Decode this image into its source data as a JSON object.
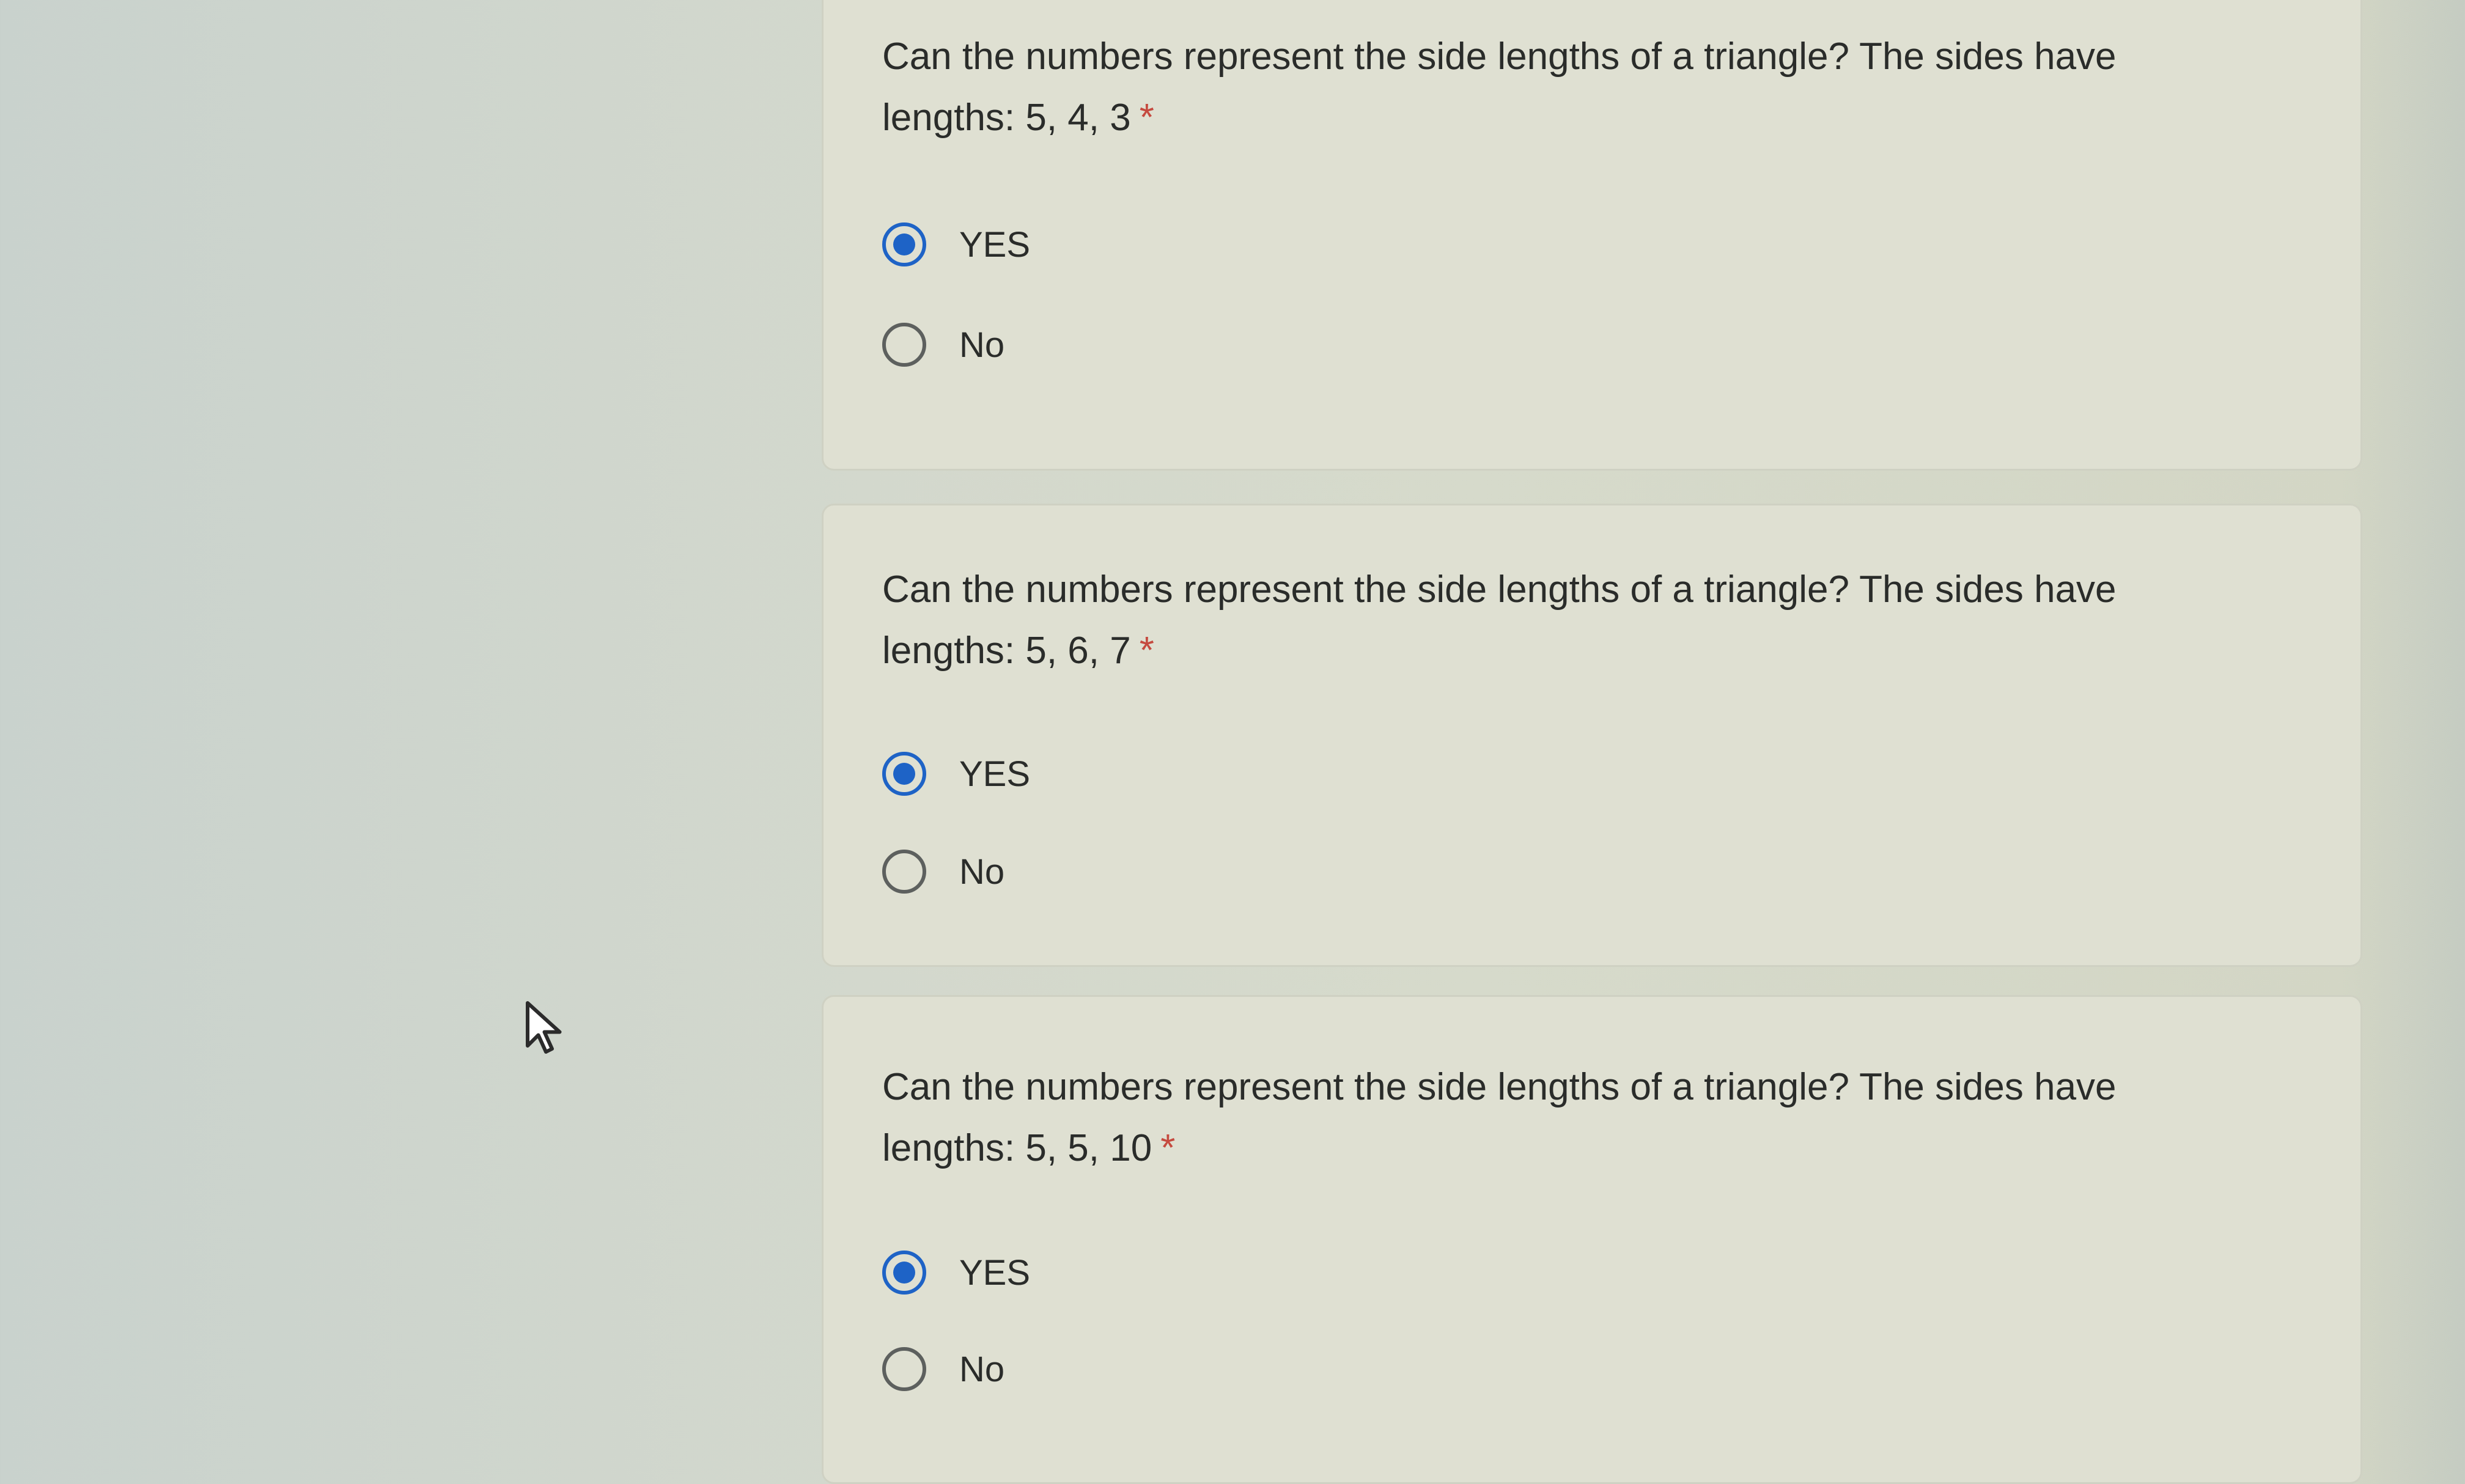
{
  "form": {
    "questions": [
      {
        "text": "Can the numbers represent the side lengths of a triangle? The sides have lengths: 5, 4, 3",
        "required_mark": "*",
        "options": [
          {
            "label": "YES",
            "selected": true
          },
          {
            "label": "No",
            "selected": false
          }
        ]
      },
      {
        "text": "Can the numbers represent the side lengths of a triangle? The sides have lengths: 5, 6, 7",
        "required_mark": "*",
        "options": [
          {
            "label": "YES",
            "selected": true
          },
          {
            "label": "No",
            "selected": false
          }
        ]
      },
      {
        "text": "Can the numbers represent the side lengths of a triangle? The sides have lengths: 5, 5, 10",
        "required_mark": "*",
        "options": [
          {
            "label": "YES",
            "selected": true
          },
          {
            "label": "No",
            "selected": false
          }
        ]
      }
    ]
  },
  "colors": {
    "accent": "#1e63c6",
    "required": "#c54a3f",
    "card_background": "#dfe0d2"
  },
  "icons": {
    "pointer": "mouse-pointer-icon"
  }
}
